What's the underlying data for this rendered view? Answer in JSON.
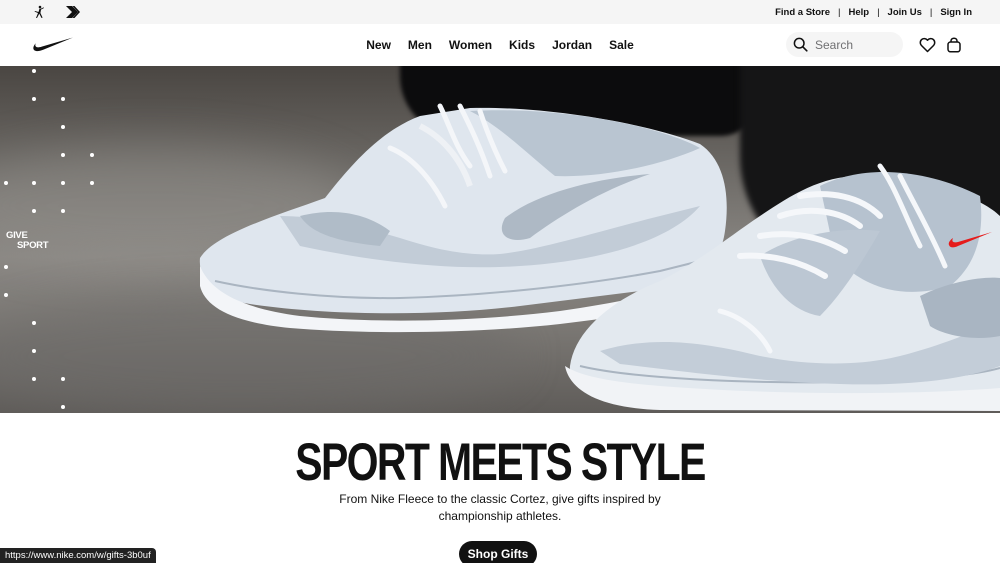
{
  "utility_bar": {
    "brands": [
      {
        "icon": "jordan-jumpman-icon"
      },
      {
        "icon": "converse-chevron-icon"
      }
    ],
    "links": [
      "Find a Store",
      "Help",
      "Join Us",
      "Sign In"
    ],
    "separator": "|"
  },
  "header": {
    "logo_icon": "nike-swoosh-icon",
    "nav": [
      "New",
      "Men",
      "Women",
      "Kids",
      "Jordan",
      "Sale"
    ],
    "search": {
      "placeholder": "Search",
      "value": ""
    },
    "icons": [
      "heart-icon",
      "bag-icon"
    ]
  },
  "hero": {
    "badge_lines": [
      "GIVE",
      "SPORT"
    ],
    "accent_color": "#e51b1b"
  },
  "promo": {
    "headline": "SPORT MEETS STYLE",
    "subtext": "From Nike Fleece to the classic Cortez, give gifts inspired by championship athletes.",
    "cta_label": "Shop Gifts"
  },
  "status_bar": {
    "url": "https://www.nike.com/w/gifts-3b0uf"
  }
}
